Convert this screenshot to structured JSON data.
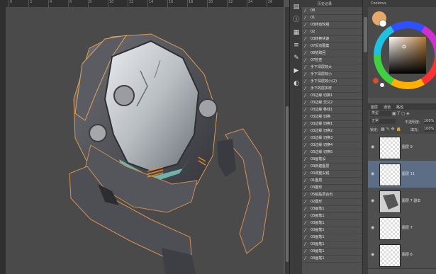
{
  "rulers": {
    "top_labels": [
      "0",
      "2",
      "4",
      "6",
      "8",
      "10",
      "12",
      "14",
      "16",
      "18",
      "20",
      "22",
      "24",
      "26"
    ]
  },
  "history": {
    "title": "历史记录",
    "items": [
      "08",
      "01",
      "03转动轮组",
      "02",
      "03转换快速",
      "07反向图案",
      "08拾取回",
      "07检查",
      "手下深层效大",
      "手下深层效小",
      "手下深层效小(2)",
      "手下的层多样",
      "03边缘 切换1",
      "03边缘 交又2",
      "03边缘 移线1",
      "03边缘 切换",
      "03边缘 切换1",
      "03边缘 切换2",
      "03边缘 切换3",
      "03边缘 切换4",
      "03边缘 切换5",
      "03画笔设",
      "03新建图层",
      "03调整尖锐",
      "01图层",
      "03图形",
      "05粘贴原合出",
      "02圆形",
      "03画笔1",
      "03画笔1",
      "03画笔1",
      "03画笔1",
      "03画笔1",
      "03画笔1",
      "03画笔1",
      "03画笔1"
    ]
  },
  "color_panel": {
    "tab_label": "Coolorus",
    "fg_color": "#e8a86a",
    "bg_color": "#ffffff",
    "wheel_pick_color": "#b07a3a"
  },
  "layers": {
    "tabs": [
      "图层",
      "通道",
      "路径"
    ],
    "filter_label": "类型",
    "blend_mode": "正常",
    "opacity_label": "不透明度:",
    "opacity_value": "100%",
    "lock_label": "锁定:",
    "fill_label": "填充:",
    "fill_value": "100%",
    "items": [
      {
        "name": "图层 9"
      },
      {
        "name": "图层 11"
      },
      {
        "name": "图层 7 副本"
      },
      {
        "name": "图层 7"
      },
      {
        "name": "图层 6"
      }
    ]
  }
}
